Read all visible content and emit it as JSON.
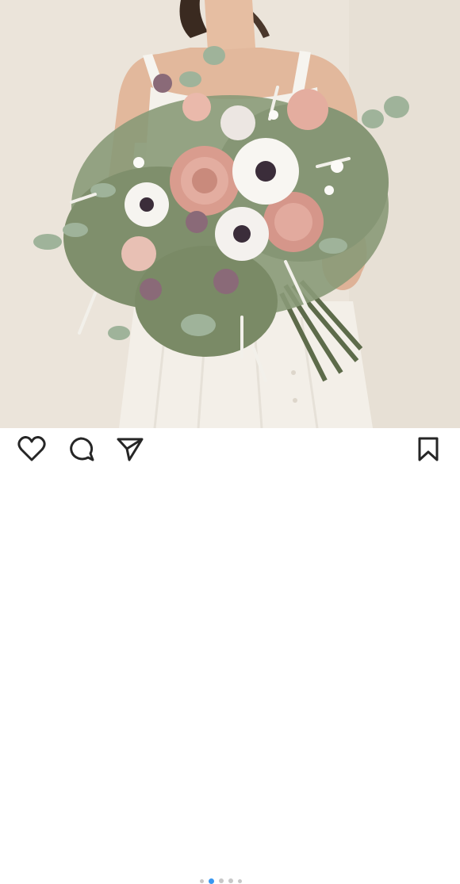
{
  "post": {
    "image_icon": "photo-bride-bouquet"
  },
  "actions": {
    "like_icon": "heart-outline-icon",
    "comment_icon": "comment-bubble-icon",
    "share_icon": "paper-plane-icon",
    "save_icon": "bookmark-icon"
  },
  "carousel": {
    "total": 5,
    "active_index": 1
  },
  "colors": {
    "background": "#ffffff",
    "icon": "#262626",
    "active_dot": "#3897f0",
    "inactive_dot": "#c7c7c7"
  }
}
